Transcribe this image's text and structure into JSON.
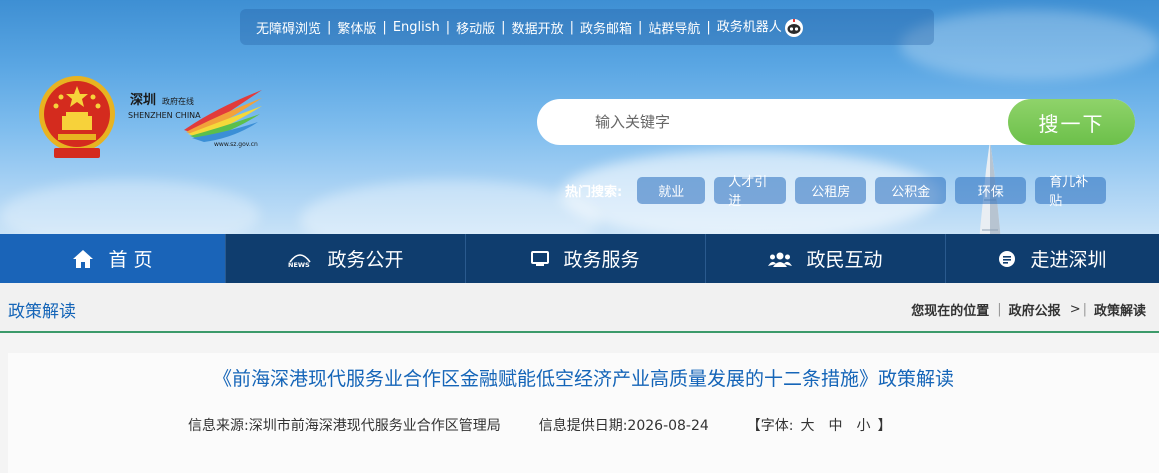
{
  "topbar": {
    "links": [
      "无障碍浏览",
      "繁体版",
      "English",
      "移动版",
      "数据开放",
      "政务邮箱",
      "站群导航",
      "政务机器人"
    ]
  },
  "logo": {
    "cn_text": "深圳",
    "subtitle": "政府在线",
    "en_text": "SHENZHEN CHINA",
    "url": "www.sz.gov.cn"
  },
  "search": {
    "placeholder": "输入关键字",
    "button_label": "搜一下"
  },
  "hot_search": {
    "label": "热门搜索:",
    "tags": [
      "就业",
      "人才引进",
      "公租房",
      "公积金",
      "环保",
      "育儿补贴"
    ]
  },
  "nav": {
    "items": [
      {
        "label": "首 页",
        "icon": "home-icon"
      },
      {
        "label": "政务公开",
        "icon": "news-icon"
      },
      {
        "label": "政务服务",
        "icon": "monitor-icon"
      },
      {
        "label": "政民互动",
        "icon": "people-icon"
      },
      {
        "label": "走进深圳",
        "icon": "chat-bubble-icon"
      }
    ]
  },
  "breadcrumb": {
    "section_title": "政策解读",
    "location_label": "您现在的位置",
    "items": [
      "政府公报",
      "政策解读"
    ]
  },
  "article": {
    "title": "《前海深港现代服务业合作区金融赋能低空经济产业高质量发展的十二条措施》政策解读",
    "source": "信息来源:深圳市前海深港现代服务业合作区管理局",
    "date": "信息提供日期:2026-08-24",
    "font_label": "【字体:",
    "font_sizes": [
      "大",
      "中",
      "小"
    ],
    "font_close": "】"
  },
  "colors": {
    "nav_bg": "#0f3d6e",
    "nav_active": "#1a64b8",
    "search_button": "#6cc04a",
    "link_blue": "#1565b8"
  }
}
